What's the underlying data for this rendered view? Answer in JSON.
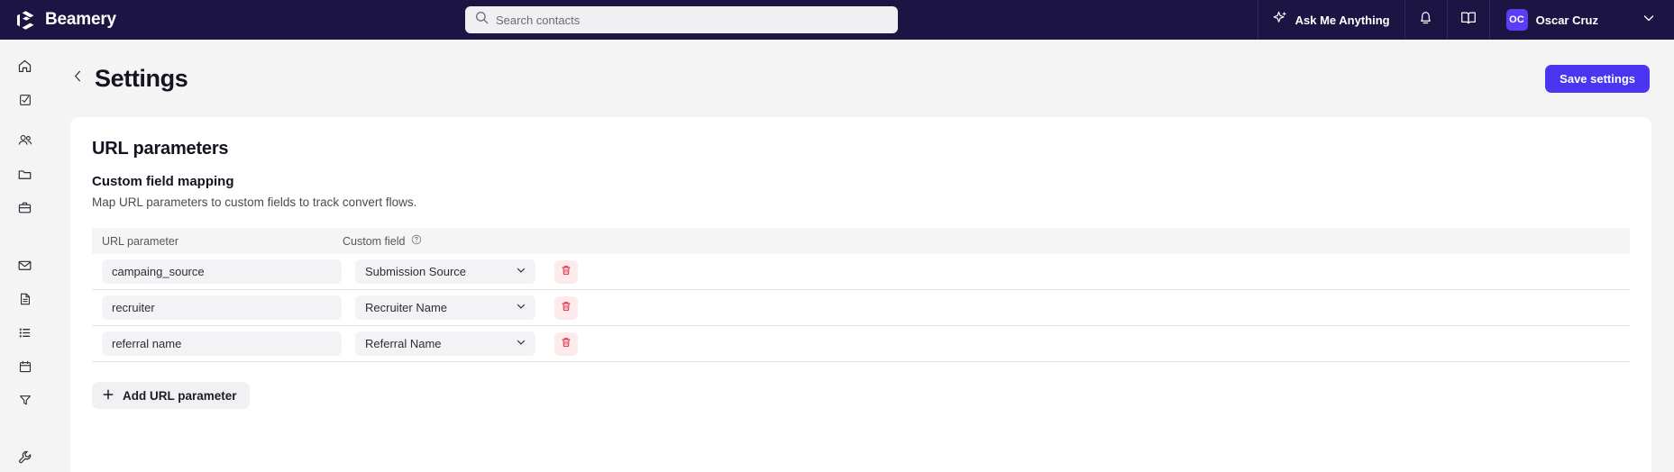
{
  "topbar": {
    "brand": "Beamery",
    "search": {
      "placeholder": "Search contacts",
      "value": ""
    },
    "ask_me_anything": "Ask Me Anything",
    "user": {
      "initials": "OC",
      "name": "Oscar Cruz"
    }
  },
  "sidebar": {
    "items": [
      {
        "name": "home",
        "icon": "home-icon"
      },
      {
        "name": "tasks",
        "icon": "task-square-icon"
      },
      {
        "name": "contacts",
        "icon": "people-icon"
      },
      {
        "name": "pools",
        "icon": "folder-icon"
      },
      {
        "name": "vacancies",
        "icon": "briefcase-icon"
      },
      {
        "name": "messages",
        "icon": "envelope-icon"
      },
      {
        "name": "pages",
        "icon": "document-icon"
      },
      {
        "name": "lists",
        "icon": "list-icon"
      },
      {
        "name": "calendar",
        "icon": "calendar-icon"
      },
      {
        "name": "filters",
        "icon": "funnel-icon"
      },
      {
        "name": "settings",
        "icon": "wrench-icon"
      }
    ]
  },
  "page": {
    "title": "Settings",
    "save_label": "Save settings"
  },
  "content": {
    "section_title": "URL parameters",
    "subsection_title": "Custom field mapping",
    "description": "Map URL parameters to custom fields to track convert flows.",
    "table": {
      "columns": [
        "URL parameter",
        "Custom field"
      ],
      "rows": [
        {
          "url_parameter": "campaing_source",
          "custom_field": "Submission Source"
        },
        {
          "url_parameter": "recruiter",
          "custom_field": "Recruiter Name"
        },
        {
          "url_parameter": "referral name",
          "custom_field": "Referral Name"
        }
      ]
    },
    "add_button_label": "Add URL parameter"
  },
  "colors": {
    "topbar_bg": "#1c1442",
    "accent": "#4a36f0",
    "avatar_bg": "#5b3df5",
    "delete_bg": "#fdeaea",
    "delete_fg": "#d92d4e",
    "page_bg": "#f4f4f5"
  }
}
